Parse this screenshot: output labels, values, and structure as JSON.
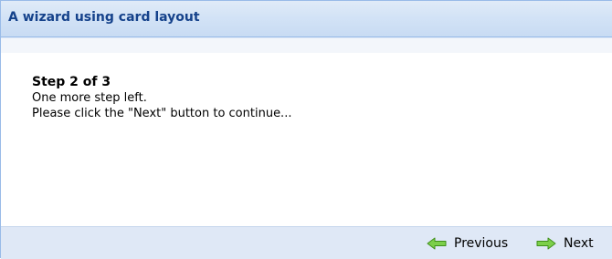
{
  "window": {
    "title": "A wizard using card layout"
  },
  "card": {
    "step_title": "Step 2 of 3",
    "line1": "One more step left.",
    "line2": "Please click the \"Next\" button to continue..."
  },
  "footer": {
    "previous_label": "Previous",
    "next_label": "Next",
    "icons": {
      "previous": "green-left-arrow-icon",
      "next": "green-right-arrow-icon"
    }
  },
  "colors": {
    "header_text": "#15428b",
    "border": "#99bbe8",
    "footer_bg": "#dfe8f6",
    "arrow_fill": "#7ccf4a",
    "arrow_stroke": "#3f8f1a"
  }
}
